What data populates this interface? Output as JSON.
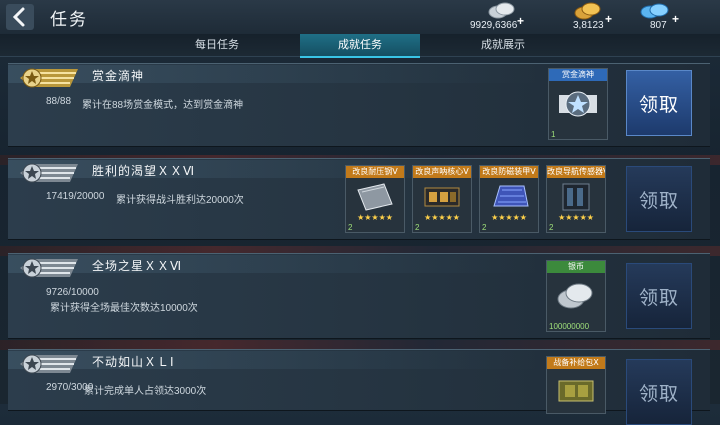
{
  "header": {
    "title": "任务"
  },
  "currency": {
    "silver": {
      "value": "9929,6366",
      "plus": "+"
    },
    "gold": {
      "value": "3,8123",
      "plus": "+"
    },
    "gem": {
      "value": "807",
      "plus": "+"
    }
  },
  "tabs": [
    {
      "label": "每日任务"
    },
    {
      "label": "成就任务"
    },
    {
      "label": "成就展示"
    }
  ],
  "tasks": [
    {
      "name": "赏金滴神",
      "progress": "88/88",
      "desc": "累计在88场赏金模式，达到赏金滴神",
      "claim": "领取",
      "rewards": [
        {
          "title": "赏金滴神",
          "count": "1",
          "icon": "badge-icon"
        }
      ]
    },
    {
      "name": "胜利的渴望ＸＸⅥ",
      "progress": "17419/20000",
      "desc": "累计获得战斗胜利达20000次",
      "claim": "领取",
      "rewards": [
        {
          "title": "改良耐压钢Ⅴ",
          "stars": "★★★★★",
          "count": "2",
          "icon": "steel-plate-icon"
        },
        {
          "title": "改良声呐核心Ⅴ",
          "stars": "★★★★★",
          "count": "2",
          "icon": "sonar-core-icon"
        },
        {
          "title": "改良防磁装甲Ⅴ",
          "stars": "★★★★★",
          "count": "2",
          "icon": "armor-icon"
        },
        {
          "title": "改良导航传感器Ⅴ",
          "stars": "★★★★★",
          "count": "2",
          "icon": "sensor-icon"
        }
      ]
    },
    {
      "name": "全场之星ＸＸⅥ",
      "progress": "9726/10000",
      "desc": "累计获得全场最佳次数达10000次",
      "claim": "领取",
      "rewards": [
        {
          "title": "银币",
          "count": "100000000",
          "icon": "silver-coin-icon"
        }
      ]
    },
    {
      "name": "不动如山ＸＬⅠ",
      "progress": "2970/3000",
      "desc": "累计完成单人占领达3000次",
      "claim": "领取",
      "rewards": [
        {
          "title": "战备补给包Ⅹ",
          "icon": "supply-pack-icon"
        }
      ]
    }
  ],
  "colors": {
    "active_tab": "#1f6f86",
    "claim_active": "#3460a4",
    "star": "#ffd24a"
  }
}
